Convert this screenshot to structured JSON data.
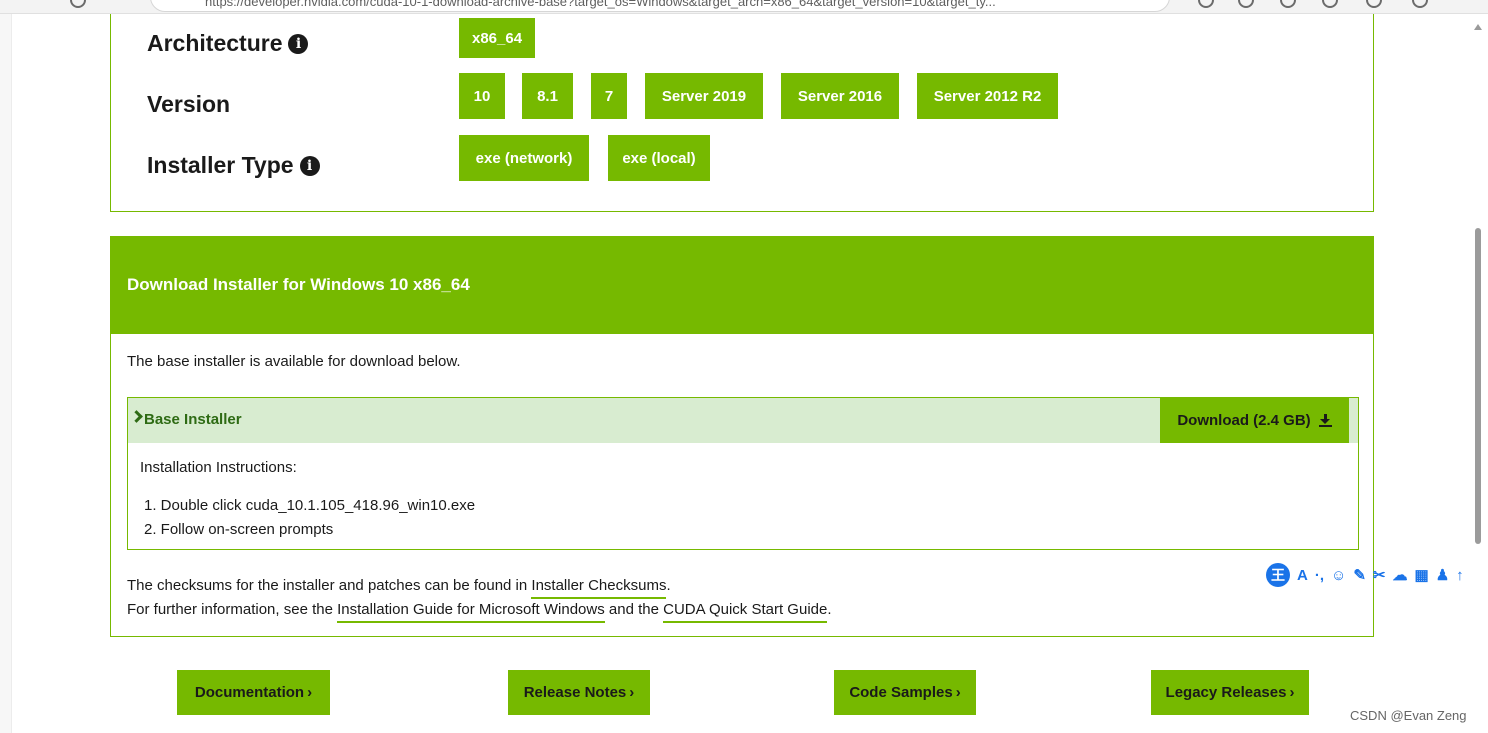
{
  "browser": {
    "url": "https://developer.nvidia.com/cuda-10-1-download-archive-base?target_os=Windows&target_arch=x86_64&target_version=10&target_ty..."
  },
  "selector": {
    "architecture": {
      "label": "Architecture",
      "options": [
        "x86_64"
      ]
    },
    "version": {
      "label": "Version",
      "options": [
        "10",
        "8.1",
        "7",
        "Server 2019",
        "Server 2016",
        "Server 2012 R2"
      ]
    },
    "installer_type": {
      "label": "Installer Type",
      "options": [
        "exe (network)",
        "exe (local)"
      ]
    }
  },
  "download": {
    "title": "Download Installer for Windows 10 x86_64",
    "available_text": "The base installer is available for download below.",
    "base_installer_label": "Base Installer",
    "download_button": "Download (2.4 GB)",
    "instructions_title": "Installation Instructions:",
    "instructions": [
      "1. Double click cuda_10.1.105_418.96_win10.exe",
      "2. Follow on-screen prompts"
    ],
    "checksum_prefix": "The checksums for the installer and patches can be found in ",
    "checksum_link": "Installer Checksums",
    "checksum_suffix": ".",
    "further_prefix": "For further information, see the ",
    "install_guide_link": "Installation Guide for Microsoft Windows",
    "further_middle": " and the ",
    "quickstart_link": "CUDA Quick Start Guide",
    "further_suffix": "."
  },
  "bottom_buttons": {
    "documentation": "Documentation",
    "release_notes": "Release Notes",
    "code_samples": "Code Samples",
    "legacy_releases": "Legacy Releases"
  },
  "toolbar_widget": {
    "logo": "王",
    "items": [
      "A",
      "·,",
      "☺",
      "✎",
      "✂",
      "☁",
      "▦",
      "♟",
      "↑"
    ]
  },
  "watermark": "CSDN @Evan Zeng",
  "colors": {
    "nvidia_green": "#76b900",
    "light_green": "#d8ecd0",
    "dark_green_text": "#2e6b14"
  }
}
